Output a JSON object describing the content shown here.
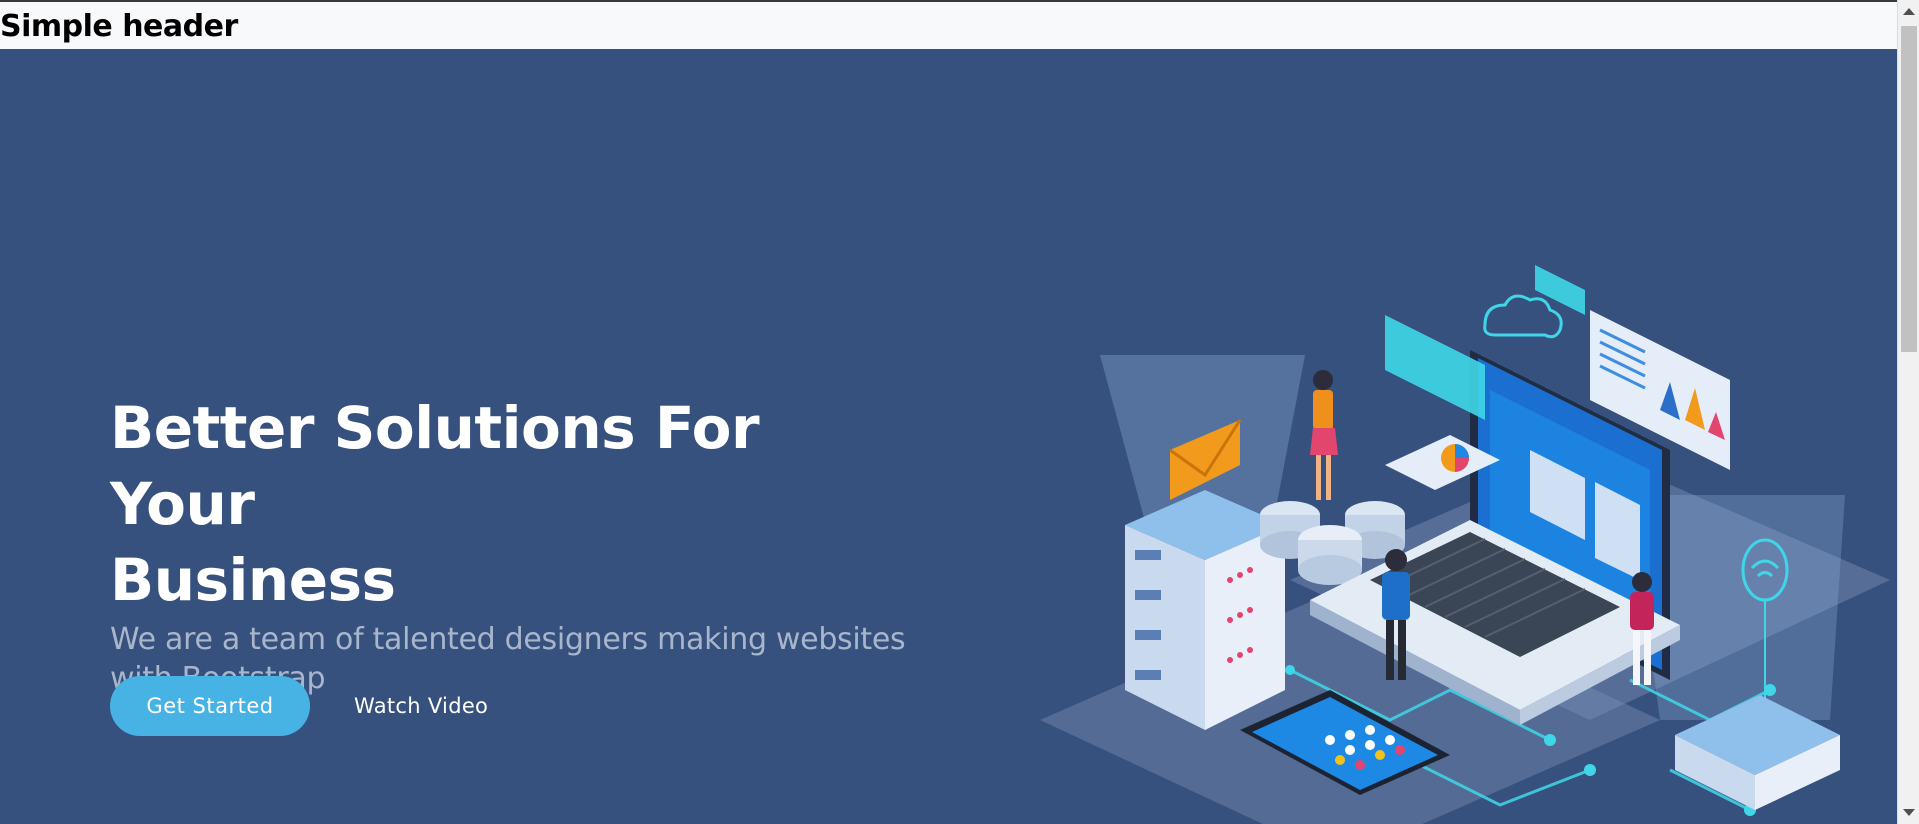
{
  "header": {
    "title": "Simple header"
  },
  "hero": {
    "title_line1": "Better Solutions For Your",
    "title_line2": "Business",
    "subtitle_line1": "We are a team of talented designers making websites",
    "subtitle_line2": "with Bootstrap",
    "primary_button": "Get Started",
    "secondary_button": "Watch Video"
  },
  "colors": {
    "background": "#37517e",
    "accent": "#47b2e4",
    "subtitle": "#a8b6cc",
    "header_bg": "#f8f9fb"
  }
}
